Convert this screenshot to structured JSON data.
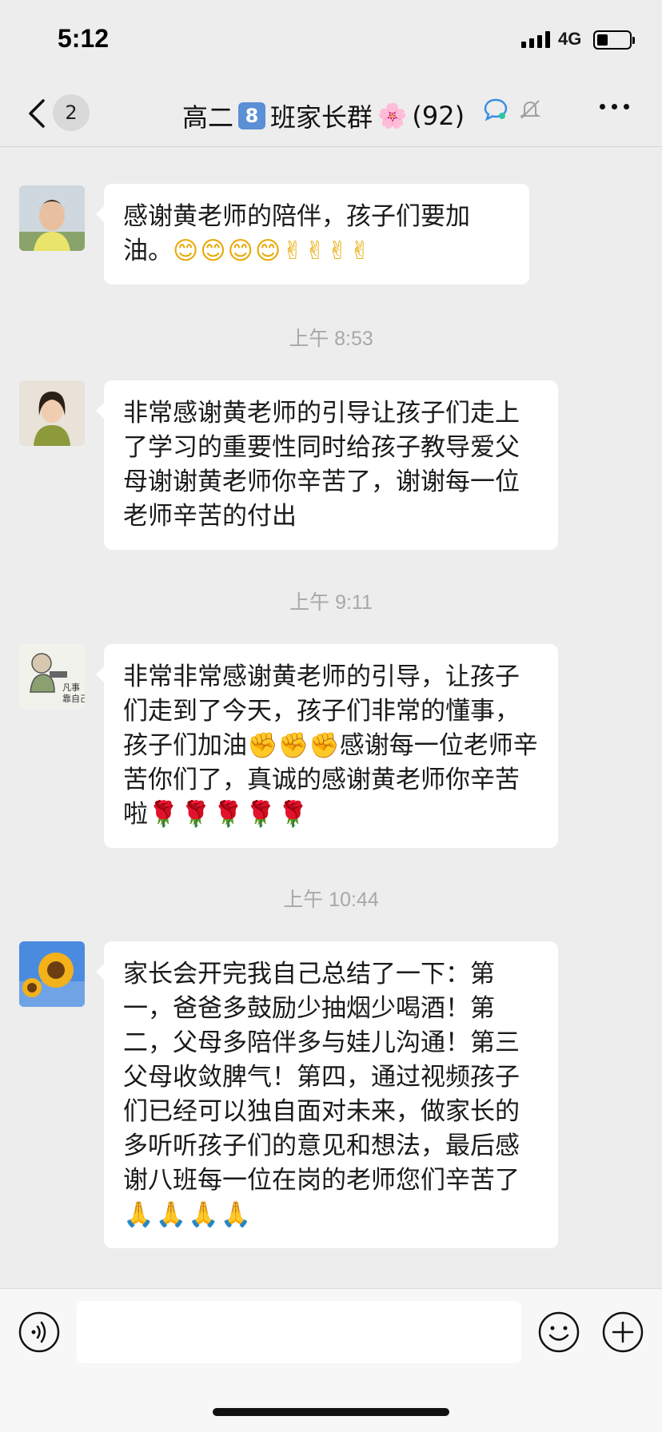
{
  "status_bar": {
    "time": "5:12",
    "network": "4G",
    "battery_level": 0.35
  },
  "nav": {
    "unread_count": "2",
    "title_prefix": "高二",
    "title_class_number": "8",
    "title_suffix": "班家长群",
    "member_count": "(92)"
  },
  "messages": [
    {
      "timestamp": "",
      "text": "感谢黄老师的陪伴，孩子们要加油。",
      "emoji": "😊😊😊😊✌✌✌✌"
    },
    {
      "timestamp": "上午 8:53",
      "text": " 非常感谢黄老师的引导让孩子们走上了学习的重要性同时给孩子教导爱父母谢谢黄老师你辛苦了，谢谢每一位老师辛苦的付出",
      "emoji": ""
    },
    {
      "timestamp": "上午 9:11",
      "text": "非常非常感谢黄老师的引导，让孩子们走到了今天，孩子们非常的懂事，孩子们加油✊✊✊感谢每一位老师辛苦你们了，真诚的感谢黄老师你辛苦啦",
      "emoji": "🌹🌹🌹🌹🌹"
    },
    {
      "timestamp": "上午 10:44",
      "text": "家长会开完我自己总结了一下：第一，爸爸多鼓励少抽烟少喝酒！第二，父母多陪伴多与娃儿沟通！第三父母收敛脾气！第四，通过视频孩子们已经可以独自面对未来，做家长的多听听孩子们的意见和想法，最后感谢八班每一位在岗的老师您们辛苦了",
      "emoji": "🙏🙏🙏🙏"
    }
  ],
  "input": {
    "placeholder": ""
  },
  "icons": {
    "back": "chevron-left-icon",
    "ai": "ai-chat-icon",
    "mute": "bell-off-icon",
    "more": "more-dots-icon",
    "voice": "voice-icon",
    "emoji": "smiley-icon",
    "plus": "plus-icon"
  },
  "colors": {
    "background": "#ededed",
    "bubble": "#ffffff",
    "timestamp": "#a8a8a8"
  }
}
